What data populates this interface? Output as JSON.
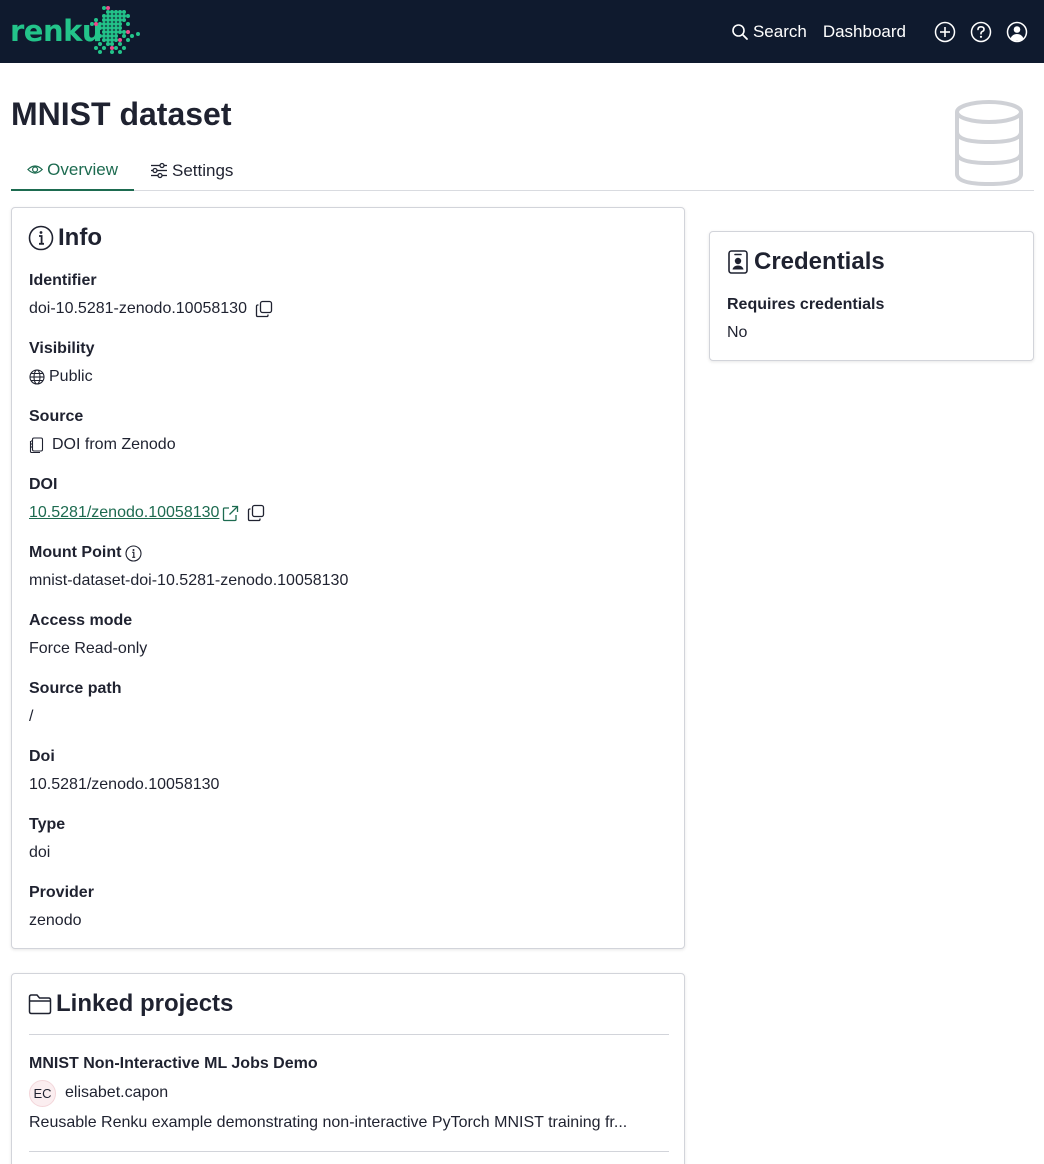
{
  "navbar": {
    "logo_text": "renku",
    "search_label": "Search",
    "dashboard_label": "Dashboard",
    "icons": [
      "plus-circle-icon",
      "question-circle-icon",
      "user-circle-icon"
    ]
  },
  "header": {
    "title": "MNIST dataset",
    "tabs": [
      {
        "label": "Overview",
        "icon": "eye-icon",
        "active": true
      },
      {
        "label": "Settings",
        "icon": "sliders-icon",
        "active": false
      }
    ]
  },
  "info": {
    "title": "Info",
    "identifier": {
      "label": "Identifier",
      "value": "doi-10.5281-zenodo.10058130"
    },
    "visibility": {
      "label": "Visibility",
      "value": "Public"
    },
    "source": {
      "label": "Source",
      "value": "DOI from Zenodo"
    },
    "doi_link": {
      "label": "DOI",
      "value": "10.5281/zenodo.10058130"
    },
    "mount_point": {
      "label": "Mount Point",
      "value": "mnist-dataset-doi-10.5281-zenodo.10058130"
    },
    "access_mode": {
      "label": "Access mode",
      "value": "Force Read-only"
    },
    "source_path": {
      "label": "Source path",
      "value": "/"
    },
    "doi": {
      "label": "Doi",
      "value": "10.5281/zenodo.10058130"
    },
    "type": {
      "label": "Type",
      "value": "doi"
    },
    "provider": {
      "label": "Provider",
      "value": "zenodo"
    }
  },
  "credentials": {
    "title": "Credentials",
    "label": "Requires credentials",
    "value": "No"
  },
  "linked_projects": {
    "title": "Linked projects",
    "items": [
      {
        "name": "MNIST Non-Interactive ML Jobs Demo",
        "owner_initials": "EC",
        "owner": "elisabet.capon",
        "description": "Reusable Renku example demonstrating non-interactive PyTorch MNIST training fr..."
      }
    ]
  },
  "colors": {
    "navbar_bg": "#0f1a2e",
    "brand_green": "#23c48a",
    "accent": "#1d6b50"
  }
}
